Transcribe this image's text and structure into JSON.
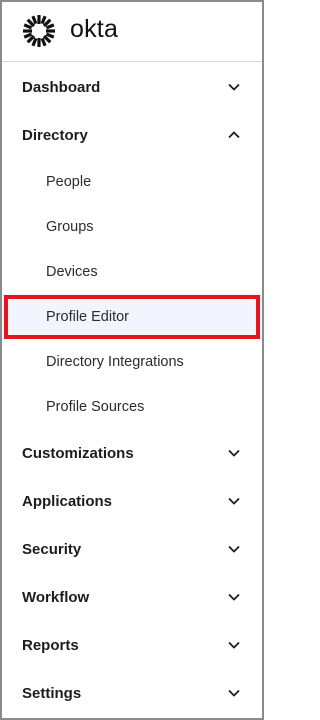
{
  "logo": {
    "text": "okta",
    "icon": "okta-sunburst-icon"
  },
  "nav": {
    "dashboard": {
      "label": "Dashboard",
      "icon": "chevron-down-icon"
    },
    "directory": {
      "label": "Directory",
      "icon": "chevron-up-icon",
      "items": [
        {
          "label": "People"
        },
        {
          "label": "Groups"
        },
        {
          "label": "Devices"
        },
        {
          "label": "Profile Editor",
          "active": true
        },
        {
          "label": "Directory Integrations"
        },
        {
          "label": "Profile Sources"
        }
      ]
    },
    "customizations": {
      "label": "Customizations",
      "icon": "chevron-down-icon"
    },
    "applications": {
      "label": "Applications",
      "icon": "chevron-down-icon"
    },
    "security": {
      "label": "Security",
      "icon": "chevron-down-icon"
    },
    "workflow": {
      "label": "Workflow",
      "icon": "chevron-down-icon"
    },
    "reports": {
      "label": "Reports",
      "icon": "chevron-down-icon"
    },
    "settings": {
      "label": "Settings",
      "icon": "chevron-down-icon"
    }
  },
  "colors": {
    "highlight": "#e8141c",
    "active_bg": "#f2f5fd",
    "text": "#1d1d21"
  }
}
